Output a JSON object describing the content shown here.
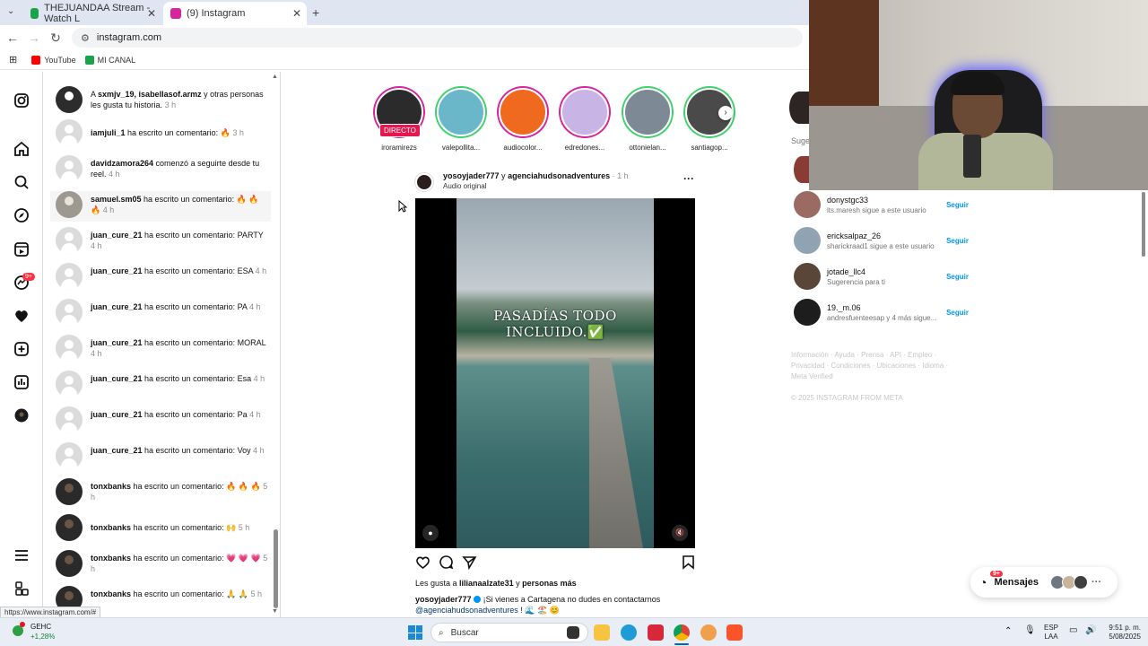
{
  "browser": {
    "tabs": [
      {
        "label": "THEJUANDAA Stream - Watch L",
        "icon_color": "#19a34a"
      },
      {
        "label": "(9) Instagram",
        "icon_color": "#d6249f"
      }
    ],
    "new_tab": "+",
    "url": "instagram.com",
    "bookmarks": [
      {
        "label": "YouTube",
        "icon_color": "#ff0000"
      },
      {
        "label": "MI CANAL",
        "icon_color": "#19a34a"
      }
    ],
    "status_url": "https://www.instagram.com/#"
  },
  "nav": {
    "icons": [
      "instagram-icon",
      "home-icon",
      "search-icon",
      "explore-icon",
      "reels-icon",
      "messages-icon",
      "notifications-icon",
      "create-icon",
      "dashboard-icon",
      "profile-icon",
      "menu-icon",
      "meta-icon"
    ],
    "messages_badge": "9+"
  },
  "notifications": [
    {
      "user": "sxmjv_19, isabellasof.armz",
      "text": "A {user} y otras personas les gusta tu historia.",
      "prefix": "A ",
      "suffix": " y otras personas les gusta tu historia.",
      "time": "3 h",
      "avatar": "photo"
    },
    {
      "user": "iamjuli_1",
      "prefix": "",
      "suffix": " ha escrito un comentario: 🔥",
      "time": "3 h",
      "avatar": "default"
    },
    {
      "user": "davidzamora264",
      "prefix": "",
      "suffix": " comenzó a seguirte desde tu reel.",
      "time": "4 h",
      "avatar": "default"
    },
    {
      "user": "samuel.sm05",
      "prefix": "",
      "suffix": " ha escrito un comentario: 🔥 🔥 🔥",
      "time": "4 h",
      "avatar": "photo"
    },
    {
      "user": "juan_cure_21",
      "prefix": "",
      "suffix": " ha escrito un comentario: PARTY",
      "time": "4 h",
      "avatar": "default"
    },
    {
      "user": "juan_cure_21",
      "prefix": "",
      "suffix": " ha escrito un comentario: ESA",
      "time": "4 h",
      "avatar": "default"
    },
    {
      "user": "juan_cure_21",
      "prefix": "",
      "suffix": " ha escrito un comentario: PA",
      "time": "4 h",
      "avatar": "default"
    },
    {
      "user": "juan_cure_21",
      "prefix": "",
      "suffix": " ha escrito un comentario: MORAL",
      "time": "4 h",
      "avatar": "default"
    },
    {
      "user": "juan_cure_21",
      "prefix": "",
      "suffix": " ha escrito un comentario: Esa",
      "time": "4 h",
      "avatar": "default"
    },
    {
      "user": "juan_cure_21",
      "prefix": "",
      "suffix": " ha escrito un comentario: Pa",
      "time": "4 h",
      "avatar": "default"
    },
    {
      "user": "juan_cure_21",
      "prefix": "",
      "suffix": " ha escrito un comentario: Voy",
      "time": "4 h",
      "avatar": "default"
    },
    {
      "user": "tonxbanks",
      "prefix": "",
      "suffix": " ha escrito un comentario: 🔥 🔥 🔥",
      "time": "5 h",
      "avatar": "dark"
    },
    {
      "user": "tonxbanks",
      "prefix": "",
      "suffix": " ha escrito un comentario: 🙌",
      "time": "5 h",
      "avatar": "dark"
    },
    {
      "user": "tonxbanks",
      "prefix": "",
      "suffix": " ha escrito un comentario: 💗 💗 💗",
      "time": "5 h",
      "avatar": "dark"
    },
    {
      "user": "tonxbanks",
      "prefix": "",
      "suffix": " ha escrito un comentario: 🙏 🙏",
      "time": "5 h",
      "avatar": "dark"
    }
  ],
  "stories": [
    {
      "name": "iroramirezs",
      "ring": "#d6249f",
      "fill": "#2b2b2b",
      "live": "DIRECTO"
    },
    {
      "name": "valepollita...",
      "ring": "#3fd16b",
      "fill": "#6ab7c9",
      "live": ""
    },
    {
      "name": "audiocolor...",
      "ring": "#d6249f",
      "fill": "#ef6a1f",
      "live": ""
    },
    {
      "name": "edredones...",
      "ring": "#d6249f",
      "fill": "#c9b4e6",
      "live": ""
    },
    {
      "name": "ottonielan...",
      "ring": "#3fd16b",
      "fill": "#7d8a96",
      "live": ""
    },
    {
      "name": "santiagop...",
      "ring": "#3fd16b",
      "fill": "#4a4a4a",
      "live": ""
    }
  ],
  "post": {
    "author": "yosoyjader777",
    "connector": " y ",
    "coauthor": "agenciahudsonadventures",
    "time": "1 h",
    "audio": "Audio original",
    "overlay_text": "PASADÍAS TODO INCLUIDO.✅",
    "likes_prefix": "Les gusta a ",
    "likes_user": "lilianaalzate31",
    "likes_suffix": " y ",
    "likes_more": "personas más",
    "caption_user": "yosoyjader777",
    "caption_text": " ¡Si vienes a Cartagena no dudes en contactarnos",
    "caption_mention": "@agenciahudsonadventures",
    "caption_end": " ! 🌊 🏖️ 😊"
  },
  "suggestions": {
    "header": "Suge",
    "items": [
      {
        "name": "donystgc33",
        "sub": "its.maresh sigue a este usuario",
        "action": "Seguir",
        "avatar": "#9b6b63"
      },
      {
        "name": "ericksalpaz_26",
        "sub": "sharickraad1 sigue a este usuario",
        "action": "Seguir",
        "avatar": "#8fa3b3"
      },
      {
        "name": "jotade_llc4",
        "sub": "Sugerencia para ti",
        "action": "Seguir",
        "avatar": "#5a4639"
      },
      {
        "name": "19._m.06",
        "sub": "andresfuenteesap y 4 más sigue...",
        "action": "Seguir",
        "avatar": "#1d1d1d"
      }
    ],
    "footer_line1": "Información · Ayuda · Prensa · API · Empleo ·",
    "footer_line2": "Privacidad · Condiciones · Ubicaciones · Idioma ·",
    "footer_line3": "Meta Verified",
    "copyright": "© 2025 INSTAGRAM FROM META"
  },
  "messages_button": {
    "label": "Mensajes",
    "badge": "9+"
  },
  "taskbar": {
    "weather_label": "GEHC",
    "weather_value": "+1,28%",
    "search_placeholder": "Buscar",
    "lang_line1": "ESP",
    "lang_line2": "LAA",
    "time": "9:51 p. m.",
    "date": "5/08/2025"
  }
}
